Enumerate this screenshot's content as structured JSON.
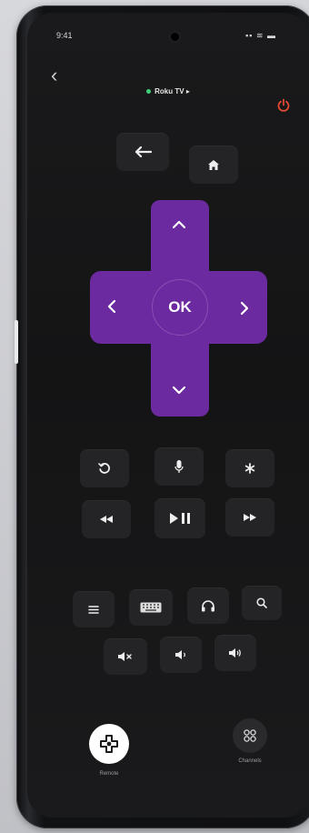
{
  "status": {
    "time": "9:41",
    "icons": "▪▪ ≋ ▬"
  },
  "header": {
    "device_name": "Roku TV",
    "device_suffix": "▸"
  },
  "dpad": {
    "ok_label": "OK"
  },
  "bottom_nav": {
    "remote_label": "Remote",
    "channels_label": "Channels"
  },
  "colors": {
    "accent": "#6c2aa0",
    "power": "#e24b2f",
    "connected": "#3fd07a",
    "button": "#242427"
  }
}
